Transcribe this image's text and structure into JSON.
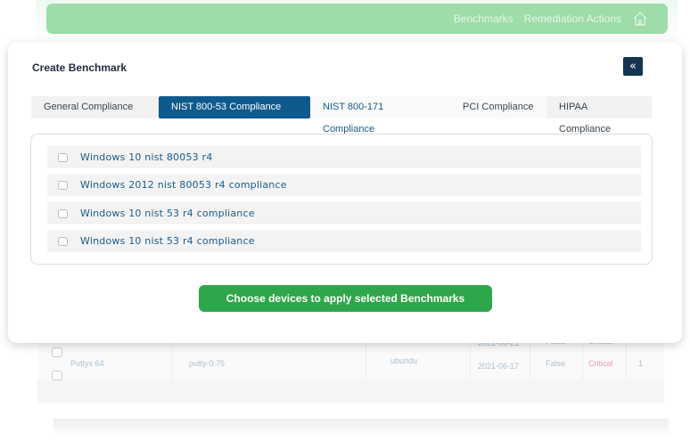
{
  "nav": {
    "items": [
      "Benchmarks",
      "Remediation Actions"
    ],
    "home_icon": "home-icon"
  },
  "background_table": {
    "row": {
      "name": "Puttyx 64",
      "version": "putty-0.75",
      "os": "ubundu",
      "date": "2021-06-17",
      "flag": "False",
      "severity": "Critical",
      "count": "1"
    },
    "partial_row": {
      "date": "2021-06-21",
      "flag": "False",
      "severity": "Critical"
    }
  },
  "modal": {
    "title": "Create Benchmark",
    "back_icon": "double-chevron-left-icon",
    "tabs": [
      {
        "label": "General Compliance",
        "state": "inactive"
      },
      {
        "label": "NIST 800-53 Compliance",
        "state": "active"
      },
      {
        "label": "NIST 800-171 Compliance",
        "state": "link"
      },
      {
        "label": "PCI Compliance",
        "state": "inactive"
      },
      {
        "label": "HIPAA Compliance",
        "state": "inactive"
      }
    ],
    "benchmarks": [
      {
        "label": "Windows 10 nist 80053 r4",
        "checked": false
      },
      {
        "label": "Windows 2012 nist 80053 r4 compliance",
        "checked": false
      },
      {
        "label": "Windows 10 nist 53 r4 compliance",
        "checked": false
      },
      {
        "label": "Windows 10 nist 53 r4 compliance",
        "checked": false
      }
    ],
    "apply_button": "Choose devices to apply selected Benchmarks"
  },
  "colors": {
    "primary": "#0e5a8d",
    "success": "#2ea74a",
    "navbar": "#9edca9",
    "critical": "#f0a0a8"
  }
}
